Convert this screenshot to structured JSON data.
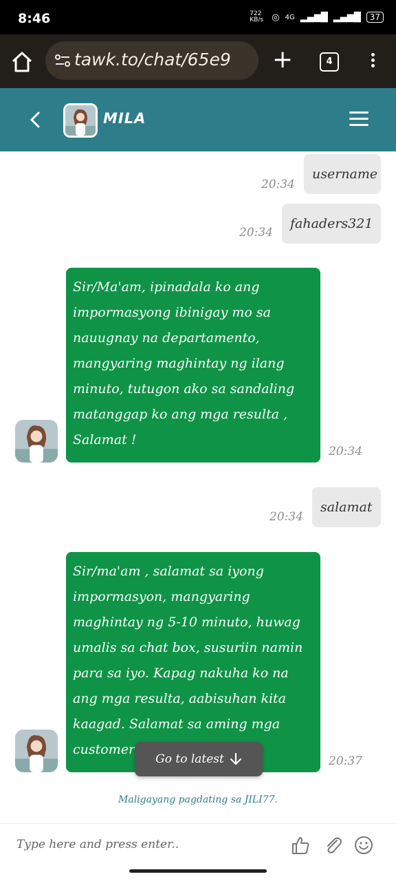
{
  "status_bar": {
    "time": "8:46",
    "speed": "722 KB/s",
    "network": "4G",
    "battery": "37"
  },
  "browser": {
    "url": "tawk.to/chat/65e9",
    "tab_count": "4"
  },
  "chat_header": {
    "agent_name": "MILA"
  },
  "messages": [
    {
      "from": "visitor",
      "text": "username",
      "time": "20:34"
    },
    {
      "from": "visitor",
      "text": "fahaders321",
      "time": "20:34"
    },
    {
      "from": "agent",
      "text": "Sir/Ma'am, ipinadala ko ang impormasyong ibinigay mo sa nauugnay na departamento, mangyaring maghintay ng ilang minuto, tutugon ako sa sandaling matanggap ko ang mga resulta , Salamat !",
      "time": "20:34"
    },
    {
      "from": "visitor",
      "text": "salamat",
      "time": "20:34"
    },
    {
      "from": "agent",
      "text": "Sir/ma'am , salamat sa iyong impormasyon, mangyaring maghintay ng 5-10 minuto, huwag umalis sa chat box, susuriin namin para sa iyo. Kapag nakuha ko na ang mga resulta, aabisuhan kita kaagad. Salamat sa aming mga customer",
      "time": "20:37"
    }
  ],
  "go_latest_label": "Go to latest",
  "welcome_text": "Maligayang pagdating sa JILI77.",
  "input": {
    "placeholder": "Type here and press enter.."
  },
  "colors": {
    "header": "#2e7d8a",
    "agent_bubble": "#0f9447",
    "visitor_bubble": "#e9e9e9"
  }
}
